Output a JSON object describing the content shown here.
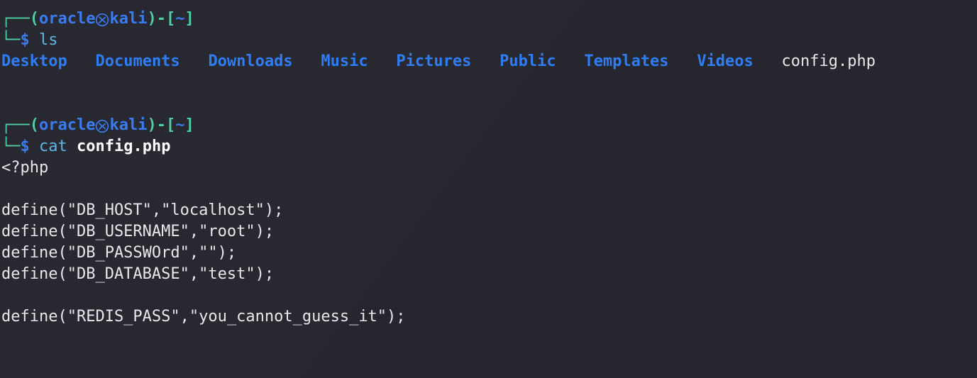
{
  "terminal": {
    "background_color": "#26262f",
    "foreground_color": "#e8e8ea",
    "prompt_box_color": "#4ecfa4",
    "prompt_user_color": "#3a7cf0",
    "dir_color": "#2f7df4",
    "command_color": "#5fb6e8"
  },
  "session": {
    "user": "oracle",
    "host": "kali",
    "separator_glyph": "☸",
    "cwd": "~",
    "prompt_open_paren": "(",
    "prompt_close_paren": ")",
    "prompt_dash": "-",
    "prompt_open_bracket": "[",
    "prompt_close_bracket": "]",
    "prompt_symbol": "$",
    "box_top": "┌──",
    "box_bottom": "└─"
  },
  "blocks": [
    {
      "command": "ls",
      "command_args": "",
      "output_entries": [
        {
          "name": "Desktop",
          "type": "dir"
        },
        {
          "name": "Documents",
          "type": "dir"
        },
        {
          "name": "Downloads",
          "type": "dir"
        },
        {
          "name": "Music",
          "type": "dir"
        },
        {
          "name": "Pictures",
          "type": "dir"
        },
        {
          "name": "Public",
          "type": "dir"
        },
        {
          "name": "Templates",
          "type": "dir"
        },
        {
          "name": "Videos",
          "type": "dir"
        },
        {
          "name": "config.php",
          "type": "file"
        }
      ]
    },
    {
      "command": "cat",
      "command_args": "config.php",
      "output_lines": [
        "<?php",
        "",
        "define(\"DB_HOST\",\"localhost\");",
        "define(\"DB_USERNAME\",\"root\");",
        "define(\"DB_PASSWOrd\",\"\");",
        "define(\"DB_DATABASE\",\"test\");",
        "",
        "define(\"REDIS_PASS\",\"you_cannot_guess_it\");"
      ]
    }
  ],
  "ls_output_text": "Desktop   Documents   Downloads   Music   Pictures   Public   Templates   Videos   config.php"
}
